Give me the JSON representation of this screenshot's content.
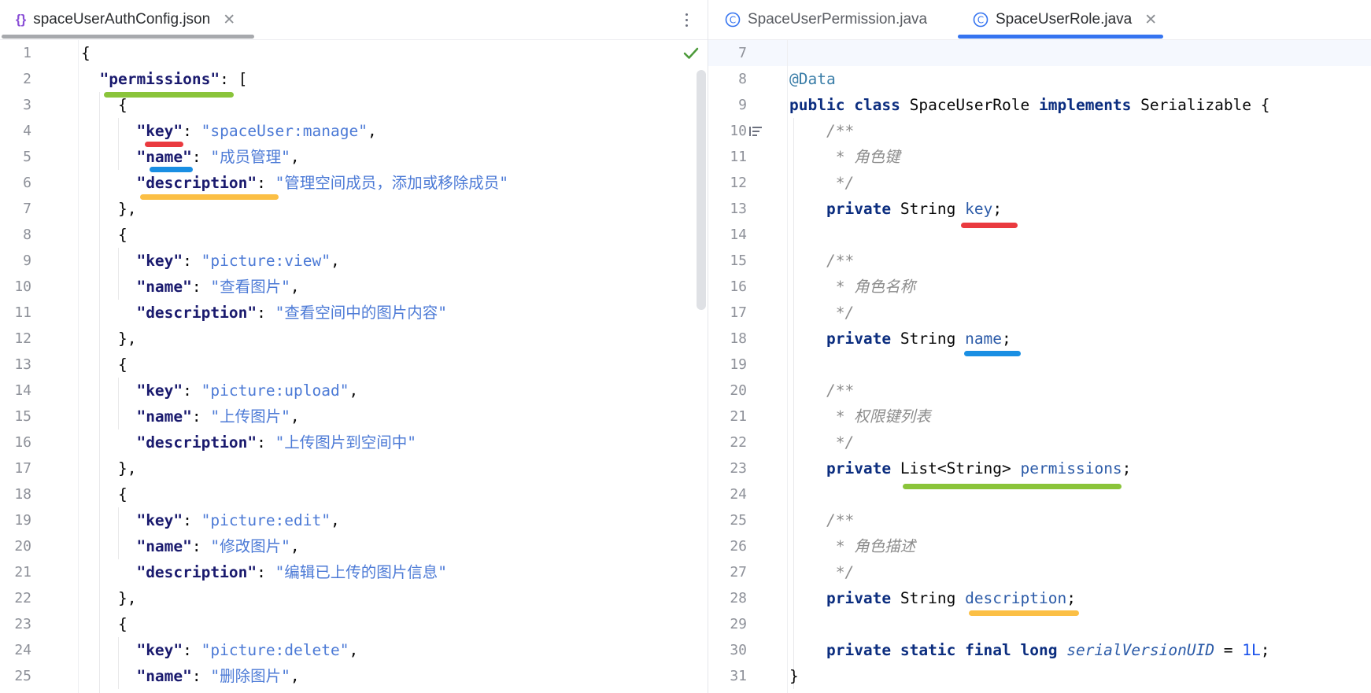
{
  "left_tab": {
    "icon": "json-braces-icon",
    "glyph": "{}",
    "label": "spaceUserAuthConfig.json",
    "close": "✕"
  },
  "right_tabs": [
    {
      "icon": "class-icon",
      "glyph": "C",
      "label": "SpaceUserPermission.java",
      "active": false
    },
    {
      "icon": "class-icon",
      "glyph": "C",
      "label": "SpaceUserRole.java",
      "close": "✕",
      "active": true
    }
  ],
  "colors": {
    "red": "#ea3a3f",
    "blue": "#1a8fe3",
    "green": "#8ac43a",
    "yellow": "#fbbf45",
    "tab_underline_left": "#a7a9ad",
    "tab_underline_right": "#3574f0"
  },
  "left_code": [
    {
      "n": "1",
      "t": "{"
    },
    {
      "n": "2",
      "t": "  \"permissions\": ["
    },
    {
      "n": "3",
      "t": "    {"
    },
    {
      "n": "4",
      "k": "key",
      "v": "spaceUser:manage"
    },
    {
      "n": "5",
      "k": "name",
      "v": "成员管理"
    },
    {
      "n": "6",
      "k": "description",
      "v": "管理空间成员，添加或移除成员",
      "last": true
    },
    {
      "n": "7",
      "t": "    },"
    },
    {
      "n": "8",
      "t": "    {"
    },
    {
      "n": "9",
      "k": "key",
      "v": "picture:view"
    },
    {
      "n": "10",
      "k": "name",
      "v": "查看图片"
    },
    {
      "n": "11",
      "k": "description",
      "v": "查看空间中的图片内容",
      "last": true
    },
    {
      "n": "12",
      "t": "    },"
    },
    {
      "n": "13",
      "t": "    {"
    },
    {
      "n": "14",
      "k": "key",
      "v": "picture:upload"
    },
    {
      "n": "15",
      "k": "name",
      "v": "上传图片"
    },
    {
      "n": "16",
      "k": "description",
      "v": "上传图片到空间中",
      "last": true
    },
    {
      "n": "17",
      "t": "    },"
    },
    {
      "n": "18",
      "t": "    {"
    },
    {
      "n": "19",
      "k": "key",
      "v": "picture:edit"
    },
    {
      "n": "20",
      "k": "name",
      "v": "修改图片"
    },
    {
      "n": "21",
      "k": "description",
      "v": "编辑已上传的图片信息",
      "last": true
    },
    {
      "n": "22",
      "t": "    },"
    },
    {
      "n": "23",
      "t": "    {"
    },
    {
      "n": "24",
      "k": "key",
      "v": "picture:delete"
    },
    {
      "n": "25",
      "k": "name",
      "v": "删除图片"
    }
  ],
  "right_code": {
    "lines": [
      "7",
      "8",
      "9",
      "10",
      "11",
      "12",
      "13",
      "14",
      "15",
      "16",
      "17",
      "18",
      "19",
      "20",
      "21",
      "22",
      "23",
      "24",
      "25",
      "26",
      "27",
      "28",
      "29",
      "30",
      "31"
    ],
    "annotation": "@Data",
    "class_decl": {
      "kw1": "public",
      "kw2": "class",
      "name": "SpaceUserRole",
      "kw3": "implements",
      "iface": "Serializable",
      "brace": "{"
    },
    "doc_open": "/**",
    "doc_close": "*/",
    "comments": [
      "角色键",
      "角色名称",
      "权限键列表",
      "角色描述"
    ],
    "private_kw": "private",
    "fields": [
      {
        "type": "String",
        "name": "key"
      },
      {
        "type": "String",
        "name": "name"
      },
      {
        "type": "List<String>",
        "name": "permissions"
      },
      {
        "type": "String",
        "name": "description"
      }
    ],
    "serial": {
      "mods": "private static final long",
      "name": "serialVersionUID",
      "eq": "=",
      "value": "1L"
    },
    "close": "}"
  }
}
